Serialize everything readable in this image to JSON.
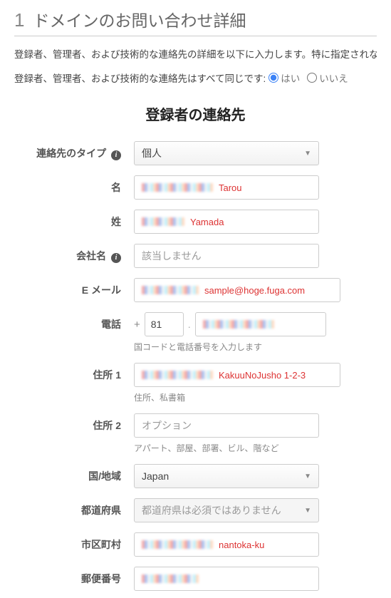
{
  "title": {
    "num": "1",
    "text": "ドメインのお問い合わせ詳細"
  },
  "desc": "登録者、管理者、および技術的な連絡先の詳細を以下に入力します。特に指定されない",
  "same_q": {
    "text": "登録者、管理者、および技術的な連絡先はすべて同じです:",
    "yes": "はい",
    "no": "いいえ"
  },
  "section_title": "登録者の連絡先",
  "labels": {
    "contact_type": "連絡先のタイプ",
    "first_name": "名",
    "last_name": "姓",
    "company": "会社名",
    "email": "E メール",
    "phone": "電話",
    "addr1": "住所 1",
    "addr2": "住所 2",
    "country": "国/地域",
    "state": "都道府県",
    "city": "市区町村",
    "postal": "郵便番号"
  },
  "values": {
    "contact_type": "個人",
    "first_name_note": "Tarou",
    "last_name_note": "Yamada",
    "company_placeholder": "該当しません",
    "email_note": "sample@hoge.fuga.com",
    "phone_cc": "81",
    "phone_hint": "国コードと電話番号を入力します",
    "addr1_note": "KakuuNoJusho 1-2-3",
    "addr1_hint": "住所、私書箱",
    "addr2_placeholder": "オプション",
    "addr2_hint": "アパート、部屋、部署、ビル、階など",
    "country": "Japan",
    "state_placeholder": "都道府県は必須ではありません",
    "city_note": "nantoka-ku"
  }
}
